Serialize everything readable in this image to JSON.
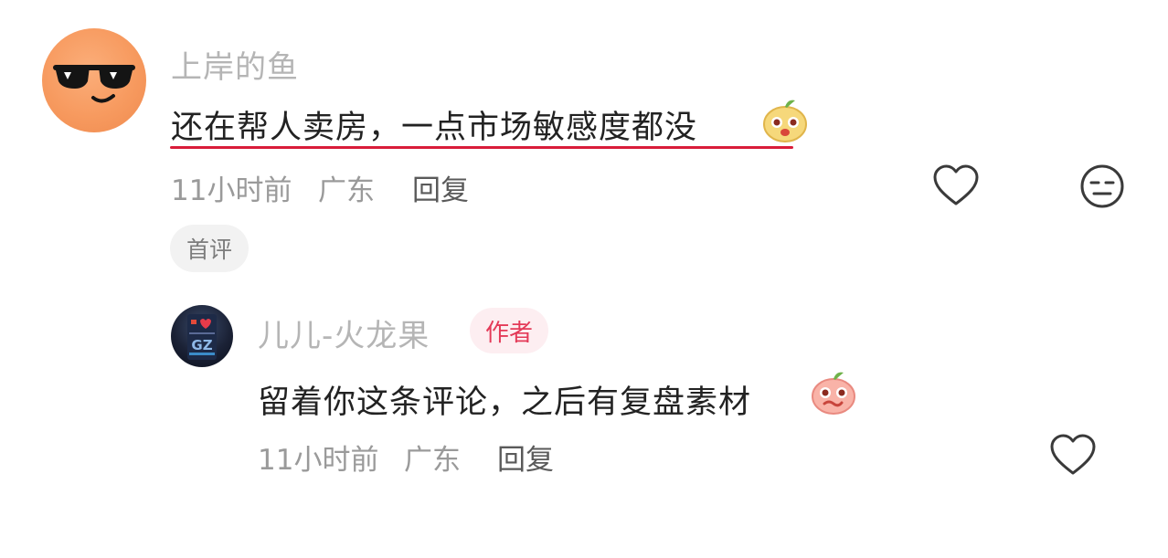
{
  "comment": {
    "username": "上岸的鱼",
    "text": "还在帮人卖房，一点市场敏感度都没",
    "time": "11小时前",
    "location": "广东",
    "reply_label": "回复",
    "tag": "首评"
  },
  "reply": {
    "username": "儿儿-火龙果",
    "author_badge": "作者",
    "text": "留着你这条评论，之后有复盘素材",
    "time": "11小时前",
    "location": "广东",
    "reply_label": "回复",
    "avatar_text": "GZ"
  },
  "colors": {
    "accent_underline": "#d91c3a",
    "author_badge_text": "#e43a58",
    "author_badge_bg": "#fdeef1",
    "avatar_main_bg": "#f79a5f"
  },
  "icons": {
    "like": "heart-outline-icon",
    "dislike": "neutral-face-icon",
    "emoji_yellow": "yellow-sticker-emoji-icon",
    "emoji_pink": "pink-sticker-emoji-icon",
    "avatar_sunglasses": "sunglasses-smile-icon"
  }
}
